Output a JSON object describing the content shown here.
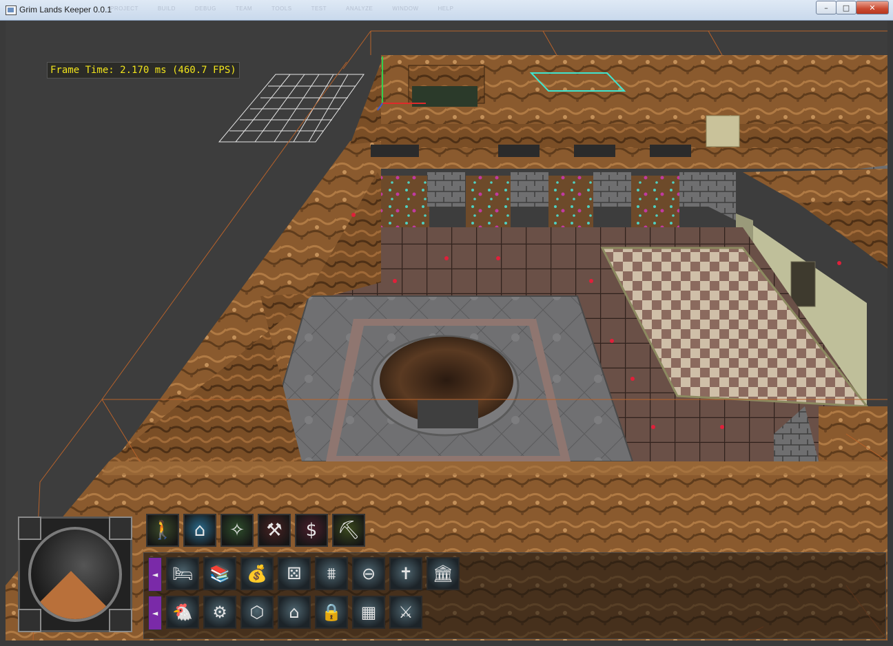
{
  "window": {
    "title": "Grim Lands Keeper 0.0.1",
    "menu": [
      "PROJECT",
      "BUILD",
      "DEBUG",
      "TEAM",
      "TOOLS",
      "TEST",
      "ANALYZE",
      "WINDOW",
      "HELP"
    ],
    "minimize_glyph": "–",
    "maximize_glyph": "□",
    "close_glyph": "✕"
  },
  "overlay": {
    "frame_time": "Frame Time: 2.170 ms (460.7 FPS)"
  },
  "hud": {
    "minimap_icon": "minimap-compass",
    "tabs": [
      {
        "name": "tab-creatures",
        "icon": "creature-icon",
        "glyph": "🚶",
        "color": "#3b4a2a"
      },
      {
        "name": "tab-rooms",
        "icon": "house-icon",
        "glyph": "⌂",
        "color": "#2b6b8c"
      },
      {
        "name": "tab-spells",
        "icon": "magic-wand-icon",
        "glyph": "✧",
        "color": "#2f4f2c"
      },
      {
        "name": "tab-workshop",
        "icon": "hammer-icon",
        "glyph": "⚒",
        "color": "#4a2323"
      },
      {
        "name": "tab-gold",
        "icon": "dollar-icon",
        "glyph": "$",
        "color": "#4a1f2c"
      },
      {
        "name": "tab-dig",
        "icon": "pickaxe-icon",
        "glyph": "⛏",
        "color": "#3c4a1e"
      }
    ],
    "row1": [
      {
        "name": "room-lair",
        "icon": "bed-icon",
        "glyph": "🛏"
      },
      {
        "name": "room-library",
        "icon": "books-icon",
        "glyph": "📚"
      },
      {
        "name": "room-treasury",
        "icon": "money-bag-icon",
        "glyph": "💰"
      },
      {
        "name": "room-casino",
        "icon": "dice-icon",
        "glyph": "⚄"
      },
      {
        "name": "room-bridge",
        "icon": "bridge-icon",
        "glyph": "⩩"
      },
      {
        "name": "room-training",
        "icon": "training-dummy-icon",
        "glyph": "⊖"
      },
      {
        "name": "room-graveyard",
        "icon": "tombstone-icon",
        "glyph": "✝"
      },
      {
        "name": "room-temple",
        "icon": "temple-icon",
        "glyph": "🏛"
      }
    ],
    "row2": [
      {
        "name": "room-hatchery",
        "icon": "chicken-icon",
        "glyph": "🐔"
      },
      {
        "name": "room-workshop",
        "icon": "gears-icon",
        "glyph": "⚙"
      },
      {
        "name": "room-trap",
        "icon": "trap-icon",
        "glyph": "⬡"
      },
      {
        "name": "room-guardpost",
        "icon": "door-icon",
        "glyph": "⌂"
      },
      {
        "name": "room-prison",
        "icon": "padlock-icon",
        "glyph": "🔒"
      },
      {
        "name": "room-wall",
        "icon": "brick-wall-icon",
        "glyph": "▦"
      },
      {
        "name": "room-barracks",
        "icon": "crossed-swords-icon",
        "glyph": "⚔"
      }
    ],
    "arrow_glyph": "◄",
    "accent": "#7a2aa8"
  }
}
